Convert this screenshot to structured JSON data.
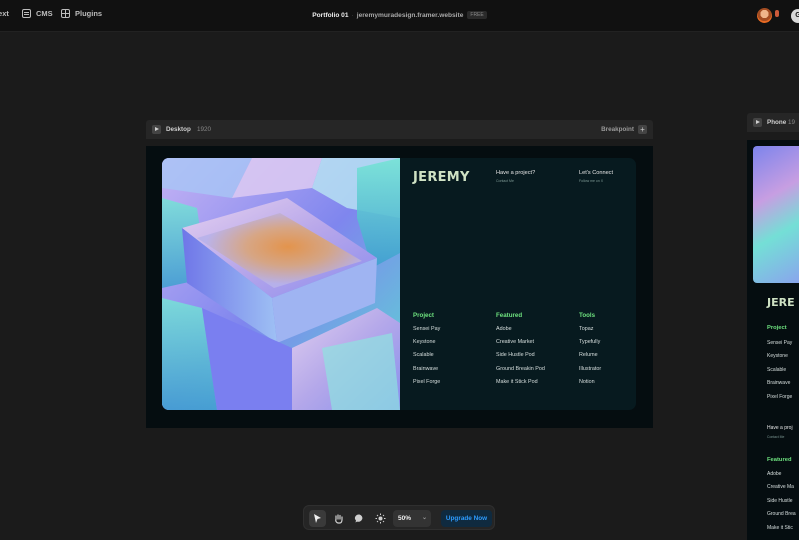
{
  "topbar": {
    "text_item": "Text",
    "cms": "CMS",
    "plugins": "Plugins",
    "project": "Portfolio 01",
    "domain": "jeremymuradesign.framer.website",
    "plan_badge": "FREE",
    "corner_button": "G"
  },
  "desktop_frame": {
    "name": "Desktop",
    "width": "1920",
    "breakpoint_label": "Breakpoint"
  },
  "phone_frame": {
    "name": "Phone",
    "width": "19"
  },
  "site": {
    "logo": "JEREMY",
    "have_project": "Have a project?",
    "contact": "Contact Me",
    "lets_connect": "Let's Connect",
    "follow": "Follow me on X",
    "columns": [
      {
        "title": "Project",
        "items": [
          "Sensei Pay",
          "Keystone",
          "Scalable",
          "Brainwave",
          "Pixel Forge"
        ]
      },
      {
        "title": "Featured",
        "items": [
          "Adobe",
          "Creative Market",
          "Side Hustle Pod",
          "Ground Breakin Pod",
          "Make it Stick Pod"
        ]
      },
      {
        "title": "Tools",
        "items": [
          "Topaz",
          "Typefully",
          "Relume",
          "Illustrator",
          "Notion"
        ]
      }
    ]
  },
  "phone_site": {
    "logo": "JERE",
    "project_title": "Project",
    "projects": [
      "Sensei Pay",
      "Keystone",
      "Scalable",
      "Brainwave",
      "Pixel Forge"
    ],
    "have_project": "Have a proj",
    "contact": "Contact Me",
    "featured_title": "Featured",
    "featured": [
      "Adobe",
      "Creative Ma",
      "Side Hustle",
      "Ground Brea",
      "Make it Stic"
    ]
  },
  "toolbar": {
    "zoom": "50%",
    "upgrade": "Upgrade Now"
  },
  "colors": {
    "accent_green": "#6ee27f",
    "upgrade_blue": "#2d9cff"
  }
}
